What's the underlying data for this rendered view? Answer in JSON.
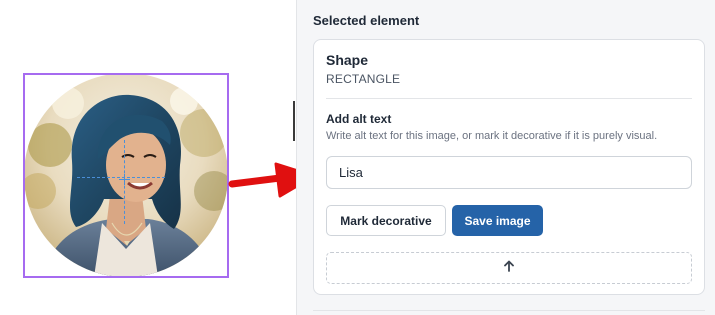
{
  "panel": {
    "title": "Selected element",
    "shape": {
      "label": "Shape",
      "type": "RECTANGLE"
    },
    "alt_text": {
      "heading": "Add alt text",
      "help": "Write alt text for this image, or mark it decorative if it is purely visual.",
      "value": "Lisa"
    },
    "buttons": {
      "mark_decorative": "Mark decorative",
      "save_image": "Save image"
    },
    "upload_icon": "arrow-up-icon"
  },
  "canvas": {
    "selection_color": "#a66bf0",
    "guide_color": "#4a8fd8",
    "arrow_color": "#e01010",
    "accent_button_color": "#2563a8"
  }
}
